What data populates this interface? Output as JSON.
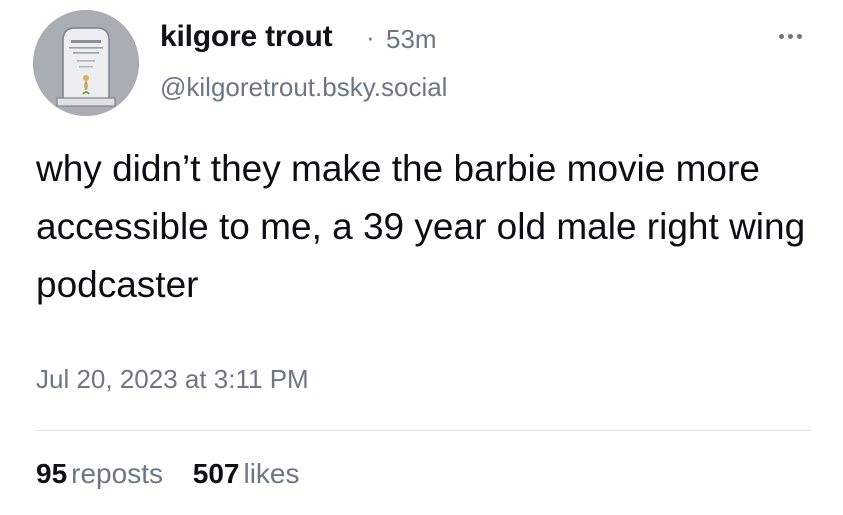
{
  "post": {
    "author": {
      "display_name": "kilgore trout",
      "handle": "@kilgoretrout.bsky.social",
      "avatar": "tombstone-avatar"
    },
    "separator": "·",
    "relative_time": "53m",
    "text": "why didn’t they make the barbie movie more accessible to me, a 39 year old male right wing podcaster",
    "timestamp": "Jul 20, 2023 at 3:11 PM",
    "menu_icon": "more-options-icon",
    "stats": {
      "reposts_count": "95",
      "reposts_label": "reposts",
      "likes_count": "507",
      "likes_label": "likes"
    }
  },
  "colors": {
    "text": "#0b0f14",
    "muted": "#6b7785",
    "divider": "#dde3ea",
    "avatar_bg": "#a9aeb5"
  }
}
